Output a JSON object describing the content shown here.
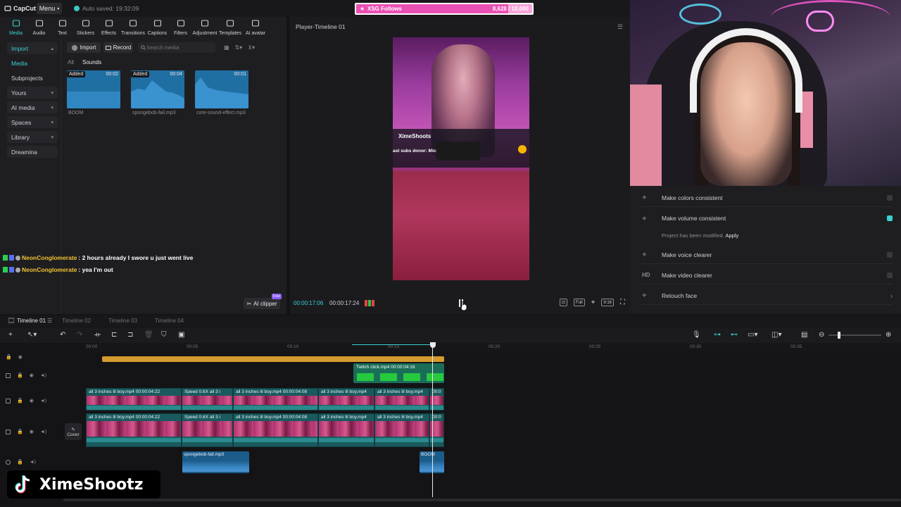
{
  "app": {
    "logo_text": "CapCut",
    "menu_label": "Menu",
    "autosave": "Auto saved: 19:32:09"
  },
  "overlay": {
    "goal_label": "XSG Follows",
    "goal_count": "8,628 / 10,000",
    "goal_progress": 0.8628,
    "watermark_name": "XimeShootz",
    "chat": [
      {
        "user": "NeonConglomerate",
        "message": ": 2 hours already I swore u just went live"
      },
      {
        "user": "NeonConglomerate",
        "message": ": yea I'm out"
      }
    ]
  },
  "toolbar": {
    "items": [
      {
        "label": "Media",
        "icon": "media-icon",
        "active": true
      },
      {
        "label": "Audio",
        "icon": "audio-icon"
      },
      {
        "label": "Text",
        "icon": "text-icon"
      },
      {
        "label": "Stickers",
        "icon": "stickers-icon"
      },
      {
        "label": "Effects",
        "icon": "effects-icon"
      },
      {
        "label": "Transitions",
        "icon": "transitions-icon"
      },
      {
        "label": "Captions",
        "icon": "captions-icon"
      },
      {
        "label": "Filters",
        "icon": "filters-icon"
      },
      {
        "label": "Adjustment",
        "icon": "adjustment-icon"
      },
      {
        "label": "Templates",
        "icon": "templates-icon"
      },
      {
        "label": "AI avatar",
        "icon": "ai-avatar-icon"
      }
    ]
  },
  "sidenav": {
    "items": [
      {
        "label": "Import",
        "chevron": true
      },
      {
        "label": "Media"
      },
      {
        "label": "Subprojects"
      },
      {
        "label": "Yours",
        "chevron": true
      },
      {
        "label": "AI media",
        "chevron": true
      },
      {
        "label": "Spaces",
        "chevron": true
      },
      {
        "label": "Library",
        "chevron": true
      },
      {
        "label": "Dreamina"
      }
    ]
  },
  "media": {
    "import_label": "Import",
    "record_label": "Record",
    "search_placeholder": "Search media",
    "filter_all": "All",
    "filter_sounds": "Sounds",
    "items": [
      {
        "name": "BOOM",
        "badge": "Added",
        "duration": "00:02"
      },
      {
        "name": "spongebob-fail.mp3",
        "badge": "Added",
        "duration": "00:04"
      },
      {
        "name": "core-sound-effect.mp3",
        "badge": "",
        "duration": "00:01"
      }
    ],
    "ai_clipper": "AI clipper",
    "ai_clipper_badge": "Free"
  },
  "player": {
    "title": "Player-Timeline 01",
    "time_current": "00:00:17:06",
    "time_total": "00:00:17:24",
    "preview_streamer": "XimeShoots",
    "preview_subs": "ast subs donor: Micro",
    "tools": [
      "Full",
      "9:16"
    ]
  },
  "enhance": {
    "options": [
      {
        "label": "Make colors consistent",
        "icon": "colors-icon",
        "on": false
      },
      {
        "label": "Make volume consistent",
        "icon": "volume-icon",
        "on": true
      },
      {
        "label": "Make voice clearer",
        "icon": "voice-icon",
        "on": false
      },
      {
        "label": "Make video clearer",
        "icon": "hd-icon",
        "icon_text": "HD",
        "on": false
      },
      {
        "label": "Retouch face",
        "icon": "retouch-icon",
        "arrow": true
      }
    ],
    "modified_note": "Project has been modified.",
    "apply_label": "Apply"
  },
  "timeline": {
    "tabs": [
      "Timeline 01",
      "Timeline 02",
      "Timeline 03",
      "Timeline 04"
    ],
    "ruler": [
      "00:00",
      "00:05",
      "00:10",
      "00:15",
      "00:20",
      "00:25",
      "00:30",
      "00:35"
    ],
    "twitch_clip": "Twitch click.mp4   00:00:04:16",
    "video_clips_row1": [
      "all 3 inches lil boy.mp4   00:00:04:22",
      "Speed 0.6X  all 3 i",
      "all 3 inches lil boy.mp4   00:00:04:08",
      "all 3 inches lil boy.mp4",
      "all 3 inches lil boy.mp4",
      "00:0"
    ],
    "audio_clips": [
      {
        "name": "spongebob-fail.mp3"
      },
      {
        "name": "BOOM"
      }
    ],
    "cover_label": "Cover"
  }
}
